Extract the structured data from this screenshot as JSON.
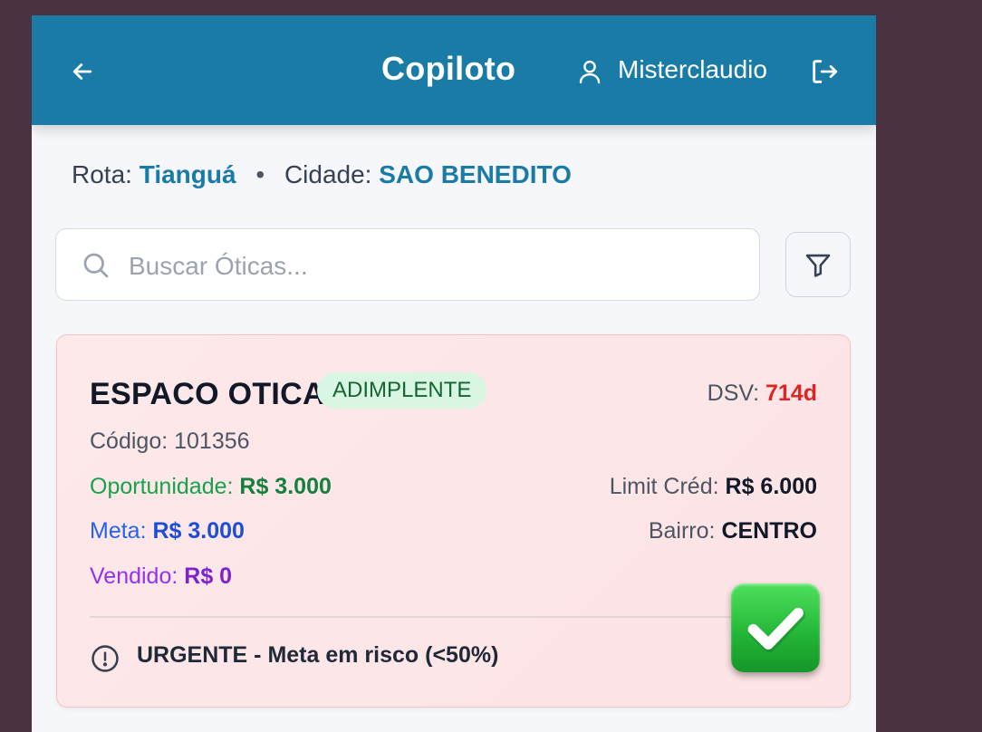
{
  "header": {
    "title": "Copiloto",
    "user_name": "Misterclaudio",
    "icons": {
      "back": "arrow-left-icon",
      "user": "user-icon",
      "logout": "logout-icon"
    }
  },
  "route": {
    "route_label": "Rota:",
    "route_value": "Tianguá",
    "separator": "•",
    "city_label": "Cidade:",
    "city_value": "SAO BENEDITO"
  },
  "search": {
    "placeholder": "Buscar Óticas...",
    "value": ""
  },
  "card": {
    "name": "ESPACO OTICA",
    "status": "ADIMPLENTE",
    "dsv_label": "DSV:",
    "dsv_value": "714d",
    "code_label": "Código:",
    "code_value": "101356",
    "opportunity_label": "Oportunidade:",
    "opportunity_value": "R$ 3.000",
    "limit_label": "Limit Créd:",
    "limit_value": "R$ 6.000",
    "meta_label": "Meta:",
    "meta_value": "R$ 3.000",
    "bairro_label": "Bairro:",
    "bairro_value": "CENTRO",
    "sold_label": "Vendido:",
    "sold_value": "R$ 0",
    "alert": "URGENTE - Meta em risco (<50%)"
  },
  "colors": {
    "header_bg": "#1a7ba6",
    "accent": "#1a7ba6",
    "card_bg": "#fde8ea",
    "status_badge_bg": "#d9f6e2",
    "dsv_value": "#dc2626",
    "check_button": "#22b436"
  }
}
